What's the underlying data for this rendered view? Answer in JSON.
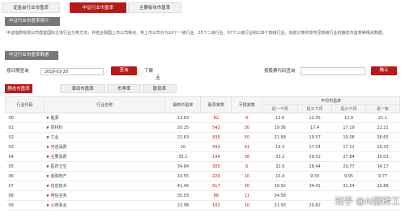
{
  "top_tabs": [
    {
      "label": "证监会行业市盈率",
      "active": false
    },
    {
      "label": "中证行业市盈率",
      "active": true
    },
    {
      "label": "主要板块市盈率",
      "active": false
    }
  ],
  "intro_section": {
    "title": "中证行业市盈率简介",
    "text": "中证指数有限公司借鉴国际主流行业分类方法，并结合我国上市公司特点，将上市公司分为10个一级行业、25个二级行业、67个三级行业和138个四级行业，目前计算并发布至四级行业的静态市盈率等相关数据。"
  },
  "query_section": {
    "title": "中证行业市盈率数据",
    "date_label": "按日期查询",
    "date_value": "2019-03-20",
    "query_button": "查询",
    "download_label": "下载",
    "stock_label": "按股票代码查询",
    "stock_placeholder": "",
    "confirm_button": "确认"
  },
  "sub_tabs": [
    {
      "label": "静态市盈率",
      "active": true
    },
    {
      "label": "滚动市盈率",
      "active": false
    },
    {
      "label": "市净率",
      "active": false
    },
    {
      "label": "股息率",
      "active": false
    }
  ],
  "table": {
    "headers": {
      "code": "行业代码",
      "name": "行业名称",
      "latest": "最新市盈率",
      "stocks": "股票家数",
      "loss": "亏损家数",
      "avg_group": "平均市盈率",
      "m1": "近一个月",
      "m3": "近三个月",
      "m6": "近六个月",
      "y1": "近一年"
    },
    "rows": [
      {
        "code": "00",
        "name": "能源",
        "latest": "13.83",
        "stocks": "82",
        "loss": "6",
        "m1": "13.6",
        "m3": "12.55",
        "m6": "12.9",
        "y1": "21.1"
      },
      {
        "code": "01",
        "name": "原材料",
        "latest": "20.25",
        "stocks": "542",
        "loss": "30",
        "m1": "19.36",
        "m3": "17.4",
        "m6": "17.19",
        "y1": "21.21"
      },
      {
        "code": "02",
        "name": "工业",
        "latest": "22.63",
        "stocks": "935",
        "loss": "50",
        "m1": "21.68",
        "m3": "19.57",
        "m6": "19.08",
        "y1": "26.65"
      },
      {
        "code": "03",
        "name": "可选消费",
        "latest": "20",
        "stocks": "593",
        "loss": "41",
        "m1": "19.3",
        "m3": "17.54",
        "m6": "17.11",
        "y1": "19.33"
      },
      {
        "code": "04",
        "name": "主要消费",
        "latest": "35.1",
        "stocks": "194",
        "loss": "38",
        "m1": "33.2",
        "m3": "29.52",
        "m6": "27.84",
        "y1": "30.03"
      },
      {
        "code": "05",
        "name": "医药卫生",
        "latest": "34.84",
        "stocks": "305",
        "loss": "6",
        "m1": "32.9",
        "m3": "28.44",
        "m6": "29.77",
        "y1": "34.17"
      },
      {
        "code": "06",
        "name": "金融地产",
        "latest": "10.55",
        "stocks": "229",
        "loss": "10",
        "m1": "10.4",
        "m3": "9.33",
        "m6": "9.05",
        "y1": "9.77"
      },
      {
        "code": "07",
        "name": "信息技术",
        "latest": "41.46",
        "stocks": "517",
        "loss": "30",
        "m1": "39.92",
        "m3": "34.41",
        "m6": "31.54",
        "y1": "32.88"
      },
      {
        "code": "08",
        "name": "电信业务",
        "latest": "35.03",
        "stocks": "86",
        "loss": "11",
        "m1": "34.58",
        "m3": "",
        "m6": "",
        "y1": ""
      },
      {
        "code": "09",
        "name": "公用事业",
        "latest": "22.98",
        "stocks": "102",
        "loss": "10",
        "m1": "21.93",
        "m3": "20.82",
        "m6": "",
        "y1": ""
      }
    ]
  },
  "watermark": "知乎 @AI搬砖工"
}
